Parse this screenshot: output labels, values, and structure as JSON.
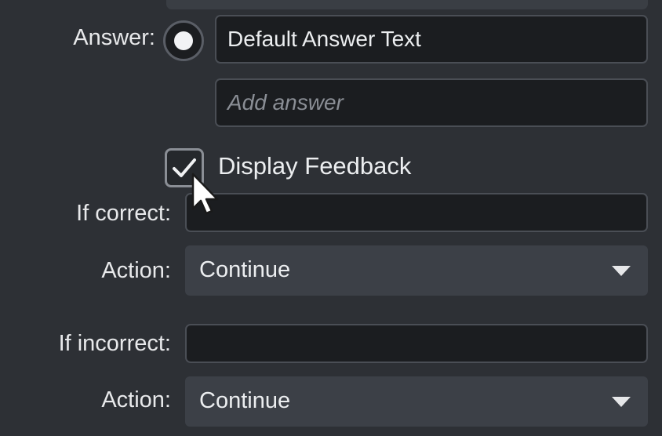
{
  "answer_section": {
    "label": "Answer:",
    "answer_value": "Default Answer Text",
    "add_answer_placeholder": "Add answer"
  },
  "feedback": {
    "display_feedback_label": "Display Feedback",
    "display_feedback_checked": true
  },
  "correct": {
    "label": "If correct:",
    "value": "",
    "action_label": "Action:",
    "action_value": "Continue"
  },
  "incorrect": {
    "label": "If incorrect:",
    "value": "",
    "action_label": "Action:",
    "action_value": "Continue"
  },
  "icons": {
    "radio": "radio-selected-icon",
    "checkbox": "checkmark-icon",
    "caret": "chevron-down-icon",
    "cursor": "mouse-pointer-icon"
  },
  "colors": {
    "background": "#2d3035",
    "field_background": "#1b1d20",
    "dropdown_background": "#3c4047",
    "text": "#e6e7e9"
  }
}
